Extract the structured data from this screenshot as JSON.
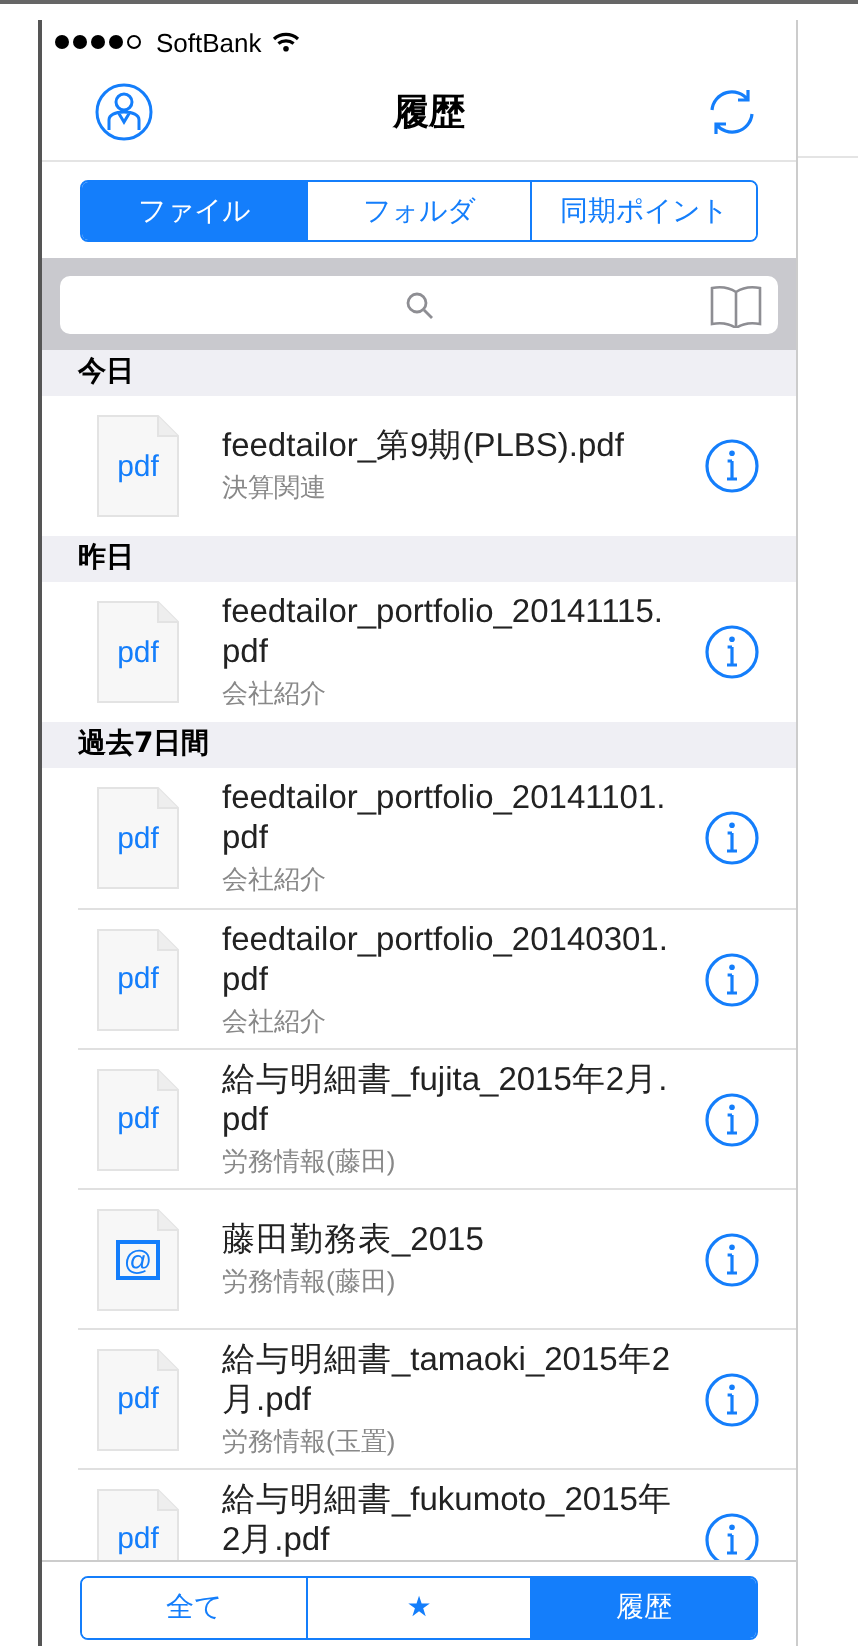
{
  "status_bar": {
    "carrier": "SoftBank"
  },
  "nav_bar": {
    "title": "履歴"
  },
  "segments": [
    {
      "label": "ファイル",
      "selected": true
    },
    {
      "label": "フォルダ",
      "selected": false
    },
    {
      "label": "同期ポイント",
      "selected": false
    }
  ],
  "sections": [
    {
      "title": "今日",
      "files": [
        {
          "kind": "pdf",
          "icon_label": "pdf",
          "name": "feedtailor_第9期(PLBS).pdf",
          "subtitle": "決算関連"
        }
      ]
    },
    {
      "title": "昨日",
      "files": [
        {
          "kind": "pdf",
          "icon_label": "pdf",
          "name": "feedtailor_portfolio_20141115.pdf",
          "subtitle": "会社紹介"
        }
      ]
    },
    {
      "title": "過去7日間",
      "files": [
        {
          "kind": "pdf",
          "icon_label": "pdf",
          "name": "feedtailor_portfolio_20141101.pdf",
          "subtitle": "会社紹介"
        },
        {
          "kind": "pdf",
          "icon_label": "pdf",
          "name": "feedtailor_portfolio_20140301.pdf",
          "subtitle": "会社紹介"
        },
        {
          "kind": "pdf",
          "icon_label": "pdf",
          "name": "給与明細書_fujita_2015年2月.pdf",
          "subtitle": "労務情報(藤田)"
        },
        {
          "kind": "web",
          "icon_label": "@",
          "name": "藤田勤務表_2015",
          "subtitle": "労務情報(藤田)"
        },
        {
          "kind": "pdf",
          "icon_label": "pdf",
          "name": "給与明細書_tamaoki_2015年2月.pdf",
          "subtitle": "労務情報(玉置)"
        },
        {
          "kind": "pdf",
          "icon_label": "pdf",
          "name": "給与明細書_fukumoto_2015年2月.pdf"
        }
      ]
    }
  ],
  "bottom_tabs": [
    {
      "label": "全て",
      "selected": false
    },
    {
      "label": "★",
      "selected": false
    },
    {
      "label": "履歴",
      "selected": true
    }
  ]
}
